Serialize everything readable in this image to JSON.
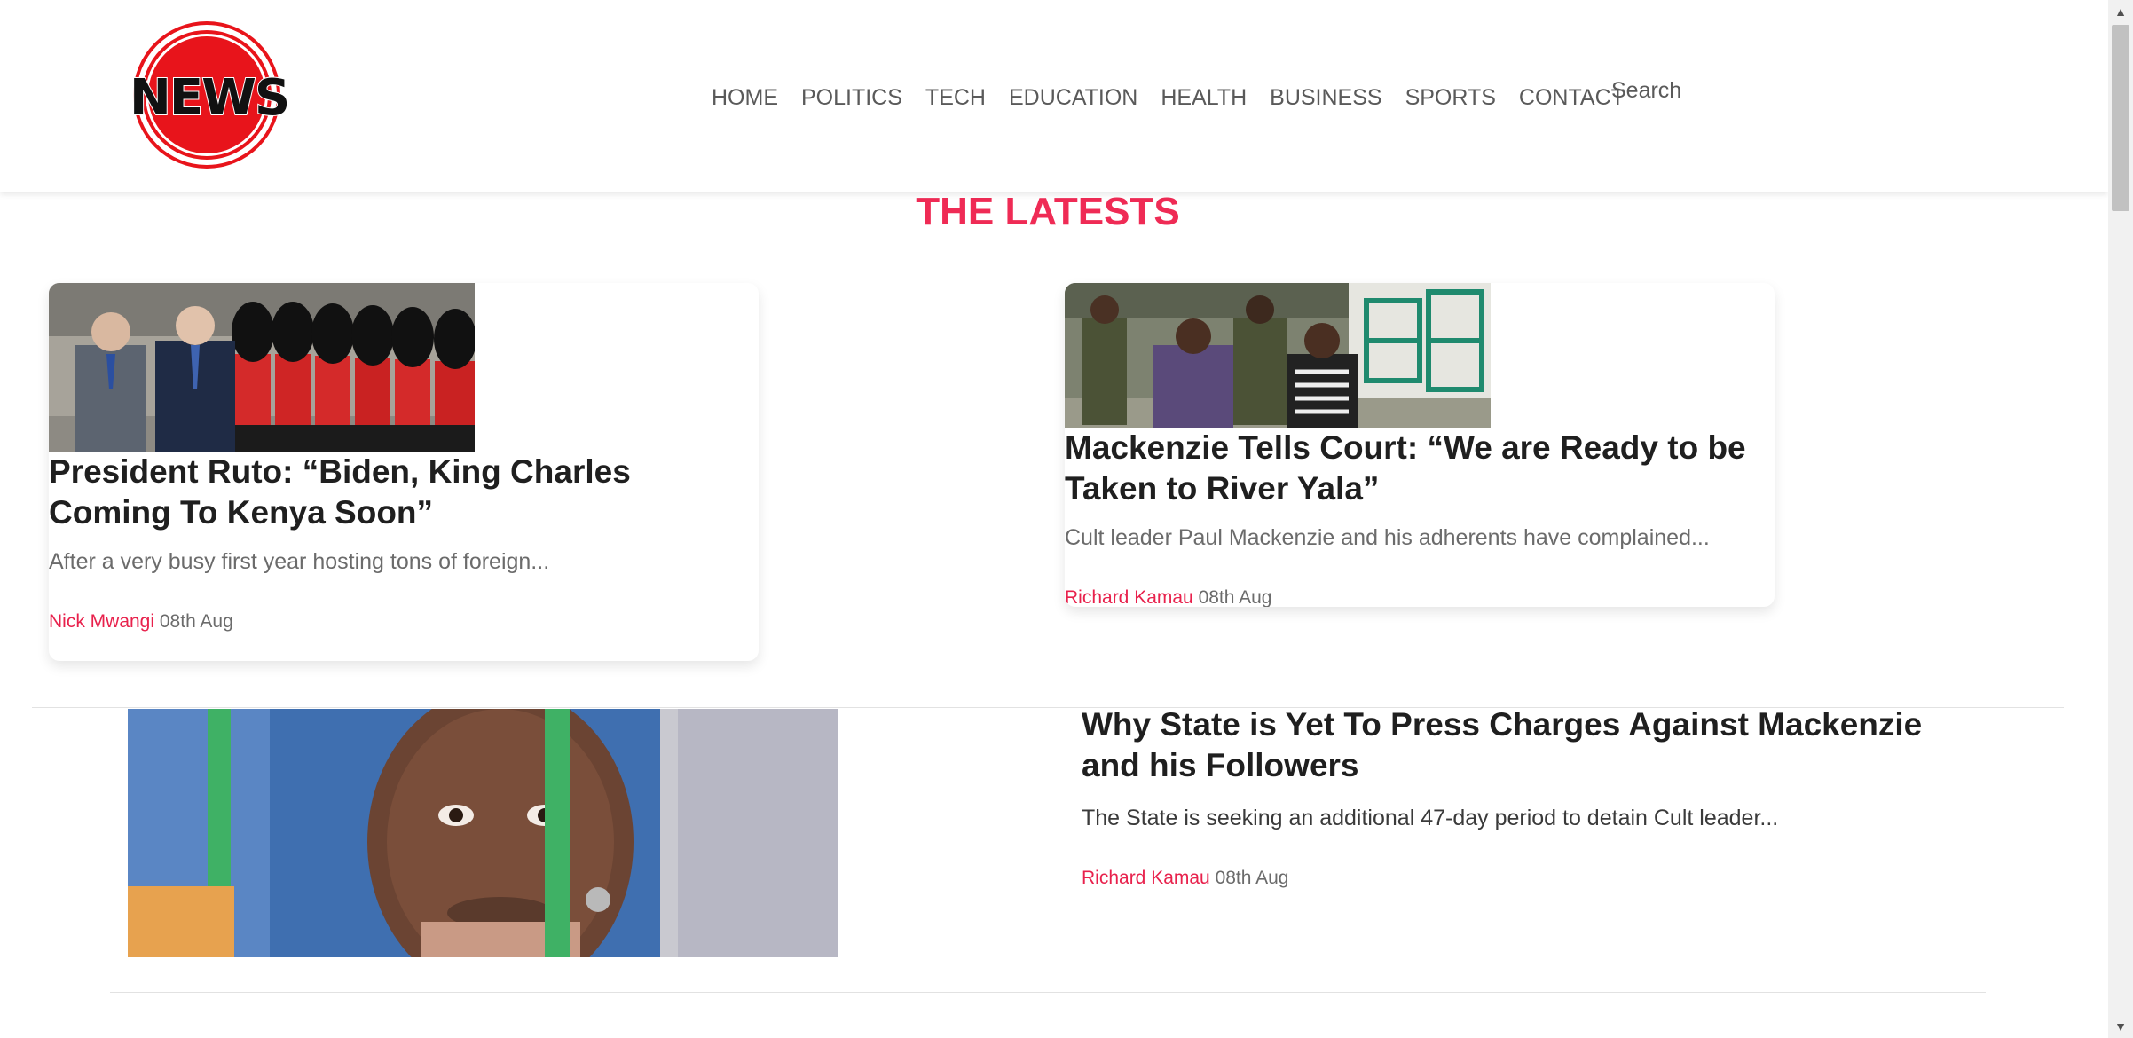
{
  "header": {
    "logo_text": "NEWS",
    "nav": [
      "HOME",
      "POLITICS",
      "TECH",
      "EDUCATION",
      "HEALTH",
      "BUSINESS",
      "SPORTS",
      "CONTACT"
    ],
    "search_label": "Search"
  },
  "colors": {
    "accent": "#ef2b55",
    "author": "#e8214c",
    "logo_red": "#e8141b"
  },
  "main": {
    "section_title": "THE LATESTS",
    "cards": [
      {
        "image": "royal-guard-photo",
        "title": "President Ruto: “Biden, King Charles Coming To Kenya Soon”",
        "excerpt": "After a very busy first year hosting tons of foreign...",
        "author": "Nick Mwangi",
        "date": "08th Aug"
      },
      {
        "image": "court-escort-photo",
        "title": "Mackenzie Tells Court: “We are Ready to be Taken to River Yala”",
        "excerpt": "Cult leader Paul Mackenzie and his adherents have complained...",
        "author": "Richard Kamau",
        "date": "08th Aug"
      }
    ],
    "featured": {
      "image": "man-behind-bars-photo",
      "title": "Why State is Yet To Press Charges Against Mackenzie and his Followers",
      "excerpt": "The State is seeking an additional 47-day period to detain Cult leader...",
      "author": "Richard Kamau",
      "date": "08th Aug"
    }
  },
  "scrollbar": {
    "up_icon": "triangle-up-icon",
    "down_icon": "triangle-down-icon"
  }
}
